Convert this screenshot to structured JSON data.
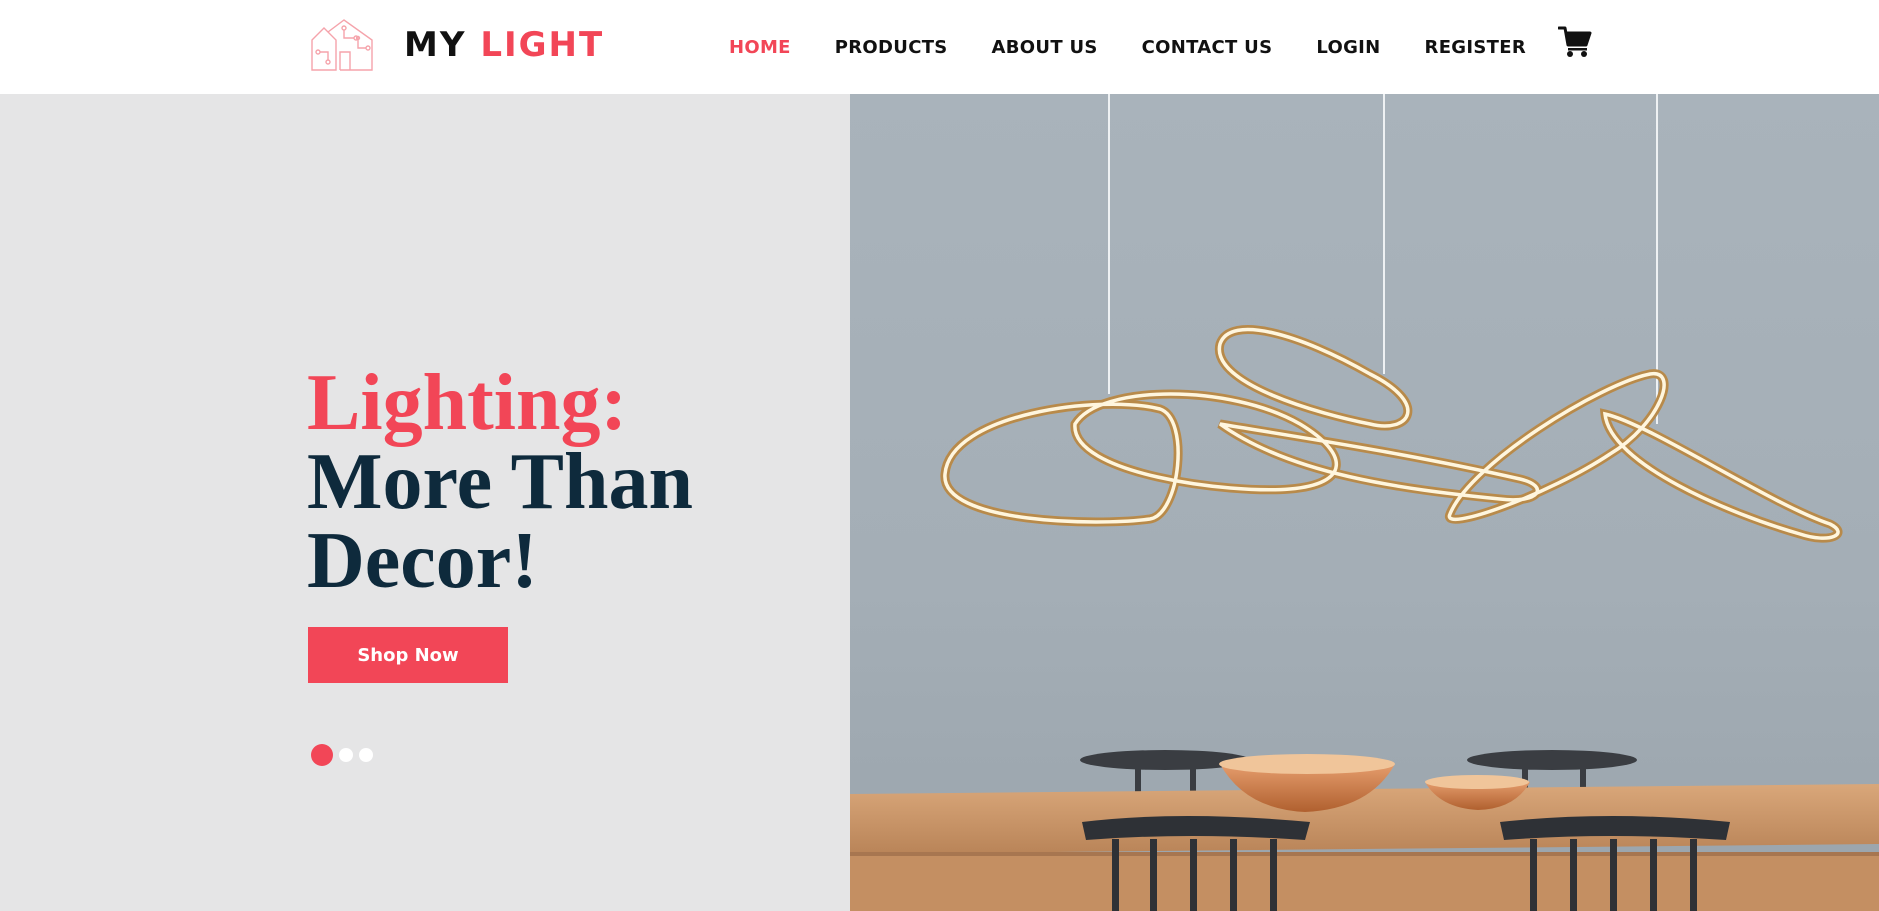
{
  "brand": {
    "name_part1": "MY",
    "name_part2": "LIGHT",
    "accent_color": "#f24657",
    "dark_color": "#0e2a3c"
  },
  "nav": {
    "items": [
      {
        "label": "HOME",
        "active": true
      },
      {
        "label": "PRODUCTS",
        "active": false
      },
      {
        "label": "ABOUT US",
        "active": false
      },
      {
        "label": "CONTACT US",
        "active": false
      },
      {
        "label": "LOGIN",
        "active": false
      },
      {
        "label": "REGISTER",
        "active": false
      }
    ],
    "cart_icon": "shopping-cart-icon"
  },
  "hero": {
    "title_line1": "Lighting:",
    "title_line2": "More Than",
    "title_line3": "Decor!",
    "button_label": "Shop Now",
    "slides_total": 3,
    "active_slide": 1
  }
}
